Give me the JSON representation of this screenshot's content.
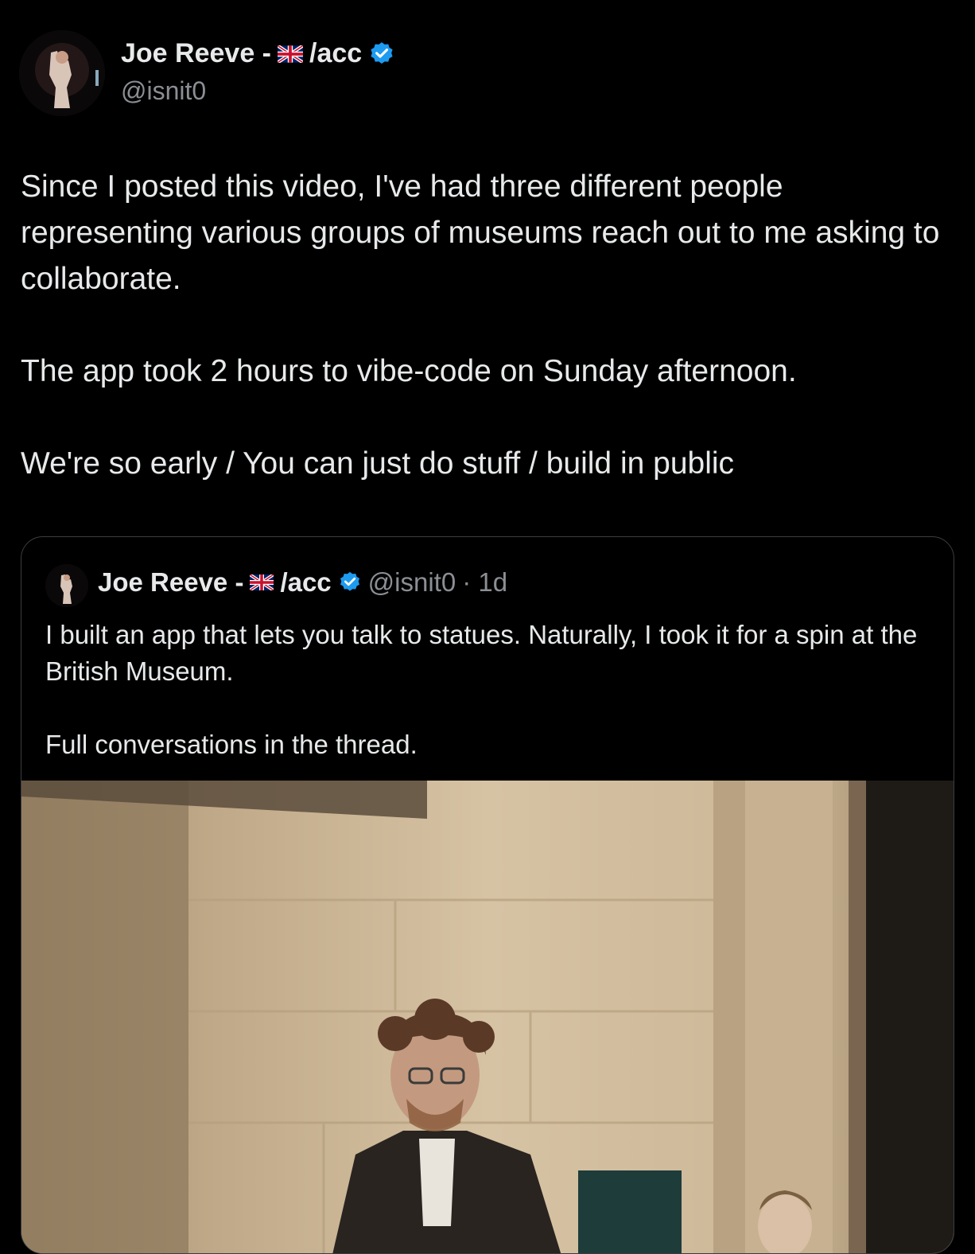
{
  "author": {
    "name": "Joe Reeve -",
    "name_suffix": "/acc",
    "handle": "@isnit0"
  },
  "tweet": {
    "paragraphs": [
      "Since I posted this video, I've had three different people representing various groups of museums reach out to me asking to collaborate.",
      "The app took 2 hours to vibe-code on Sunday afternoon.",
      "We're so early / You can just do stuff / build in public"
    ]
  },
  "quoted_tweet": {
    "name": "Joe Reeve -",
    "name_suffix": "/acc",
    "handle": "@isnit0",
    "time": "· 1d",
    "paragraphs": [
      "I built an app that lets you talk to statues. Naturally, I took it for a spin at the British Museum.",
      "Full conversations in the thread."
    ]
  },
  "colors": {
    "background": "#000000",
    "text": "#e7e9ea",
    "secondary_text": "#8b8f94",
    "verified_blue": "#1d9bf0",
    "quote_border": "#3a3d41"
  },
  "icons": {
    "flag": "uk-flag-icon",
    "verified": "verified-badge-icon"
  }
}
